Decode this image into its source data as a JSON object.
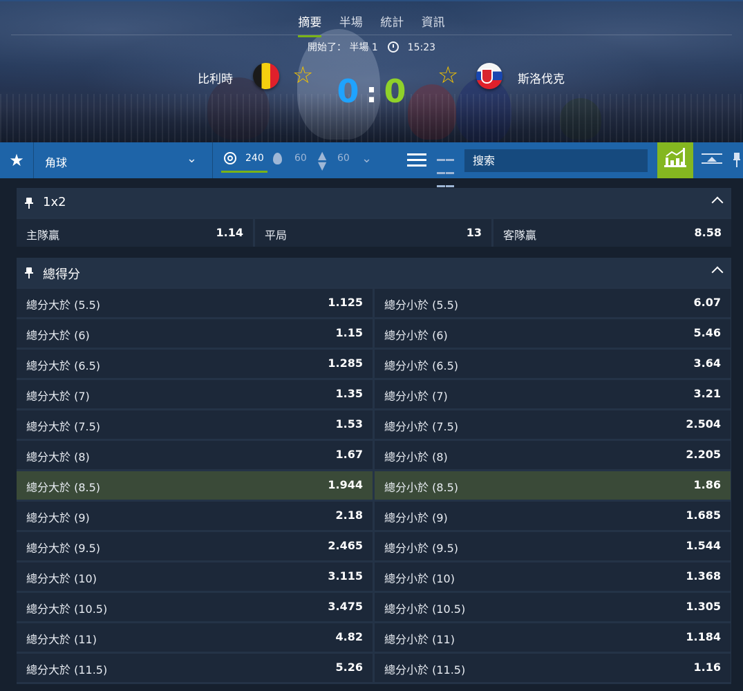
{
  "hero": {
    "tabs": [
      "摘要",
      "半場",
      "統計",
      "資訊"
    ],
    "active_tab": 0,
    "status_text": "開始了： 半場 1",
    "time": "15:23",
    "home_team": "比利時",
    "away_team": "斯洛伐克",
    "home_score": "0",
    "score_separator": ":",
    "away_score": "0",
    "home_score_color": "#1fa3ff",
    "away_score_color": "#8fd12a"
  },
  "toolbar": {
    "market_select": "角球",
    "count_all": "240",
    "count_popular": "60",
    "count_updown": "60",
    "search_placeholder": "搜索",
    "accent_color": "#84b720"
  },
  "market_1x2": {
    "title": "1x2",
    "home_label": "主隊贏",
    "home_odds": "1.14",
    "draw_label": "平局",
    "draw_odds": "13",
    "away_label": "客隊贏",
    "away_odds": "8.58"
  },
  "market_total": {
    "title": "總得分",
    "highlight_index": 6,
    "rows": [
      {
        "over_label": "總分大於 (5.5)",
        "over_odds": "1.125",
        "under_label": "總分小於 (5.5)",
        "under_odds": "6.07"
      },
      {
        "over_label": "總分大於 (6)",
        "over_odds": "1.15",
        "under_label": "總分小於 (6)",
        "under_odds": "5.46"
      },
      {
        "over_label": "總分大於 (6.5)",
        "over_odds": "1.285",
        "under_label": "總分小於 (6.5)",
        "under_odds": "3.64"
      },
      {
        "over_label": "總分大於 (7)",
        "over_odds": "1.35",
        "under_label": "總分小於 (7)",
        "under_odds": "3.21"
      },
      {
        "over_label": "總分大於 (7.5)",
        "over_odds": "1.53",
        "under_label": "總分小於 (7.5)",
        "under_odds": "2.504"
      },
      {
        "over_label": "總分大於 (8)",
        "over_odds": "1.67",
        "under_label": "總分小於 (8)",
        "under_odds": "2.205"
      },
      {
        "over_label": "總分大於 (8.5)",
        "over_odds": "1.944",
        "under_label": "總分小於 (8.5)",
        "under_odds": "1.86"
      },
      {
        "over_label": "總分大於 (9)",
        "over_odds": "2.18",
        "under_label": "總分小於 (9)",
        "under_odds": "1.685"
      },
      {
        "over_label": "總分大於 (9.5)",
        "over_odds": "2.465",
        "under_label": "總分小於 (9.5)",
        "under_odds": "1.544"
      },
      {
        "over_label": "總分大於 (10)",
        "over_odds": "3.115",
        "under_label": "總分小於 (10)",
        "under_odds": "1.368"
      },
      {
        "over_label": "總分大於 (10.5)",
        "over_odds": "3.475",
        "under_label": "總分小於 (10.5)",
        "under_odds": "1.305"
      },
      {
        "over_label": "總分大於 (11)",
        "over_odds": "4.82",
        "under_label": "總分小於 (11)",
        "under_odds": "1.184"
      },
      {
        "over_label": "總分大於 (11.5)",
        "over_odds": "5.26",
        "under_label": "總分小於 (11.5)",
        "under_odds": "1.16"
      }
    ]
  }
}
